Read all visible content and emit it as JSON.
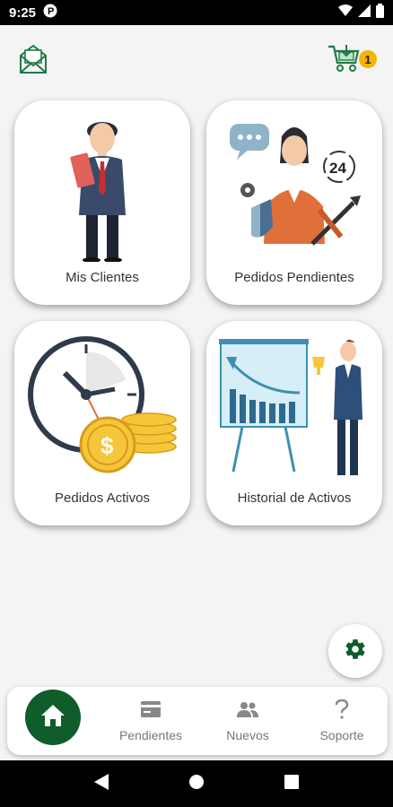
{
  "status_bar": {
    "time": "9:25",
    "app_icon": "p-circle-icon",
    "icons": [
      "wifi-icon",
      "signal-icon",
      "battery-icon"
    ]
  },
  "top_bar": {
    "mail_icon": "mail-icon",
    "cart_icon": "cart-icon",
    "cart_count": "1"
  },
  "cards": [
    {
      "label": "Mis Clientes",
      "icon": "client-illustration"
    },
    {
      "label": "Pedidos Pendientes",
      "icon": "support-illustration"
    },
    {
      "label": "Pedidos Activos",
      "icon": "clock-coins-illustration"
    },
    {
      "label": "Historial de Activos",
      "icon": "chart-presentation-illustration"
    }
  ],
  "fab": {
    "icon": "gear-icon"
  },
  "bottom_nav": {
    "home": {
      "icon": "home-icon"
    },
    "items": [
      {
        "label": "Pendientes",
        "icon": "card-icon"
      },
      {
        "label": "Nuevos",
        "icon": "users-icon"
      },
      {
        "label": "Soporte",
        "icon": "question-icon"
      }
    ]
  },
  "colors": {
    "primary": "#0e5d2a",
    "badge": "#f5b400",
    "background": "#f4f4f4"
  }
}
